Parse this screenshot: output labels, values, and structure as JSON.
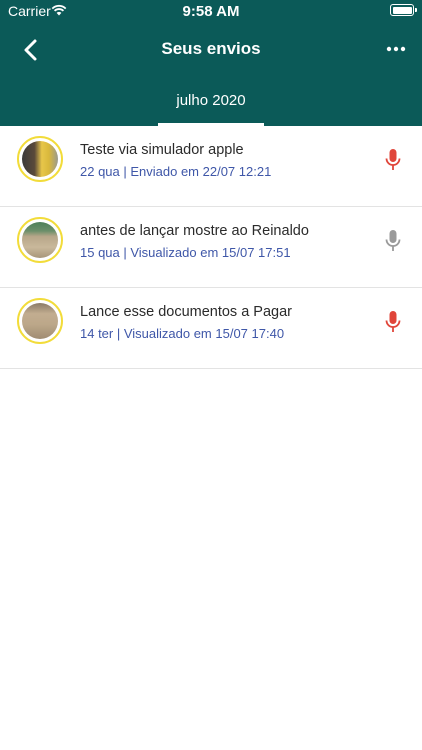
{
  "status_bar": {
    "carrier": "Carrier",
    "time": "9:58 AM"
  },
  "nav": {
    "title": "Seus envios",
    "back_icon": "chevron-left-icon",
    "more_icon": "ellipsis-icon"
  },
  "month_tab": {
    "label": "julho 2020"
  },
  "colors": {
    "header": "#0b5a58",
    "accent_text": "#3f57a8",
    "mic_active": "#e0453a",
    "mic_inactive": "#9a9a9a",
    "avatar_ring": "#f2dc3a"
  },
  "items": [
    {
      "title": "Teste via simulador apple",
      "subtitle": "22 qua | Enviado em 22/07 12:21",
      "mic_state": "active"
    },
    {
      "title": "antes de lançar mostre ao Reinaldo",
      "subtitle": "15 qua | Visualizado em 15/07 17:51",
      "mic_state": "inactive"
    },
    {
      "title": "Lance esse documentos a Pagar",
      "subtitle": "14 ter | Visualizado em 15/07 17:40",
      "mic_state": "active"
    }
  ]
}
